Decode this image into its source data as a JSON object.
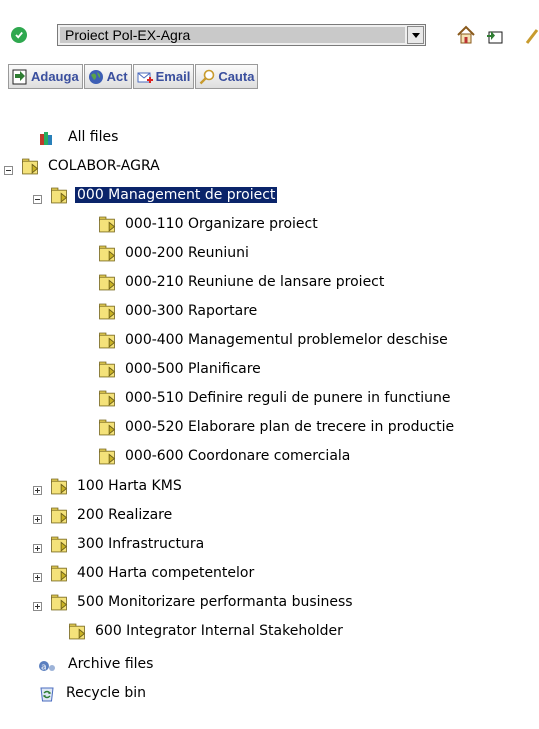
{
  "project": {
    "selected": "Proiect Pol-EX-Agra"
  },
  "toolbar": {
    "add_label": "Adauga",
    "act_label": "Act",
    "email_label": "Email",
    "search_label": "Cauta"
  },
  "tree": {
    "all_files": "All files",
    "root": "COLABOR-AGRA",
    "folders": [
      {
        "label": "000 Management de proiect",
        "expanded": true,
        "selected": true,
        "children": [
          "000-110 Organizare proiect",
          "000-200 Reuniuni",
          "000-210 Reuniune de lansare proiect",
          "000-300 Raportare",
          "000-400 Managementul problemelor deschise",
          "000-500 Planificare",
          "000-510 Definire reguli de punere in functiune",
          "000-520 Elaborare plan de trecere in productie",
          "000-600 Coordonare comerciala"
        ]
      },
      {
        "label": "100 Harta KMS",
        "expanded": false
      },
      {
        "label": "200 Realizare",
        "expanded": false
      },
      {
        "label": "300 Infrastructura",
        "expanded": false
      },
      {
        "label": "400 Harta competentelor",
        "expanded": false
      },
      {
        "label": "500 Monitorizare performanta business",
        "expanded": false
      },
      {
        "label": "600 Integrator Internal Stakeholder",
        "expanded": null
      }
    ],
    "archive": "Archive files",
    "recycle": "Recycle bin"
  },
  "icons": {
    "status": "check-circle-icon",
    "home": "home-icon",
    "add_folder": "add-folder-icon",
    "folder": "folder-arrow-icon",
    "all_files": "books-icon",
    "archive": "archive-icon",
    "recycle": "recycle-bin-icon"
  }
}
